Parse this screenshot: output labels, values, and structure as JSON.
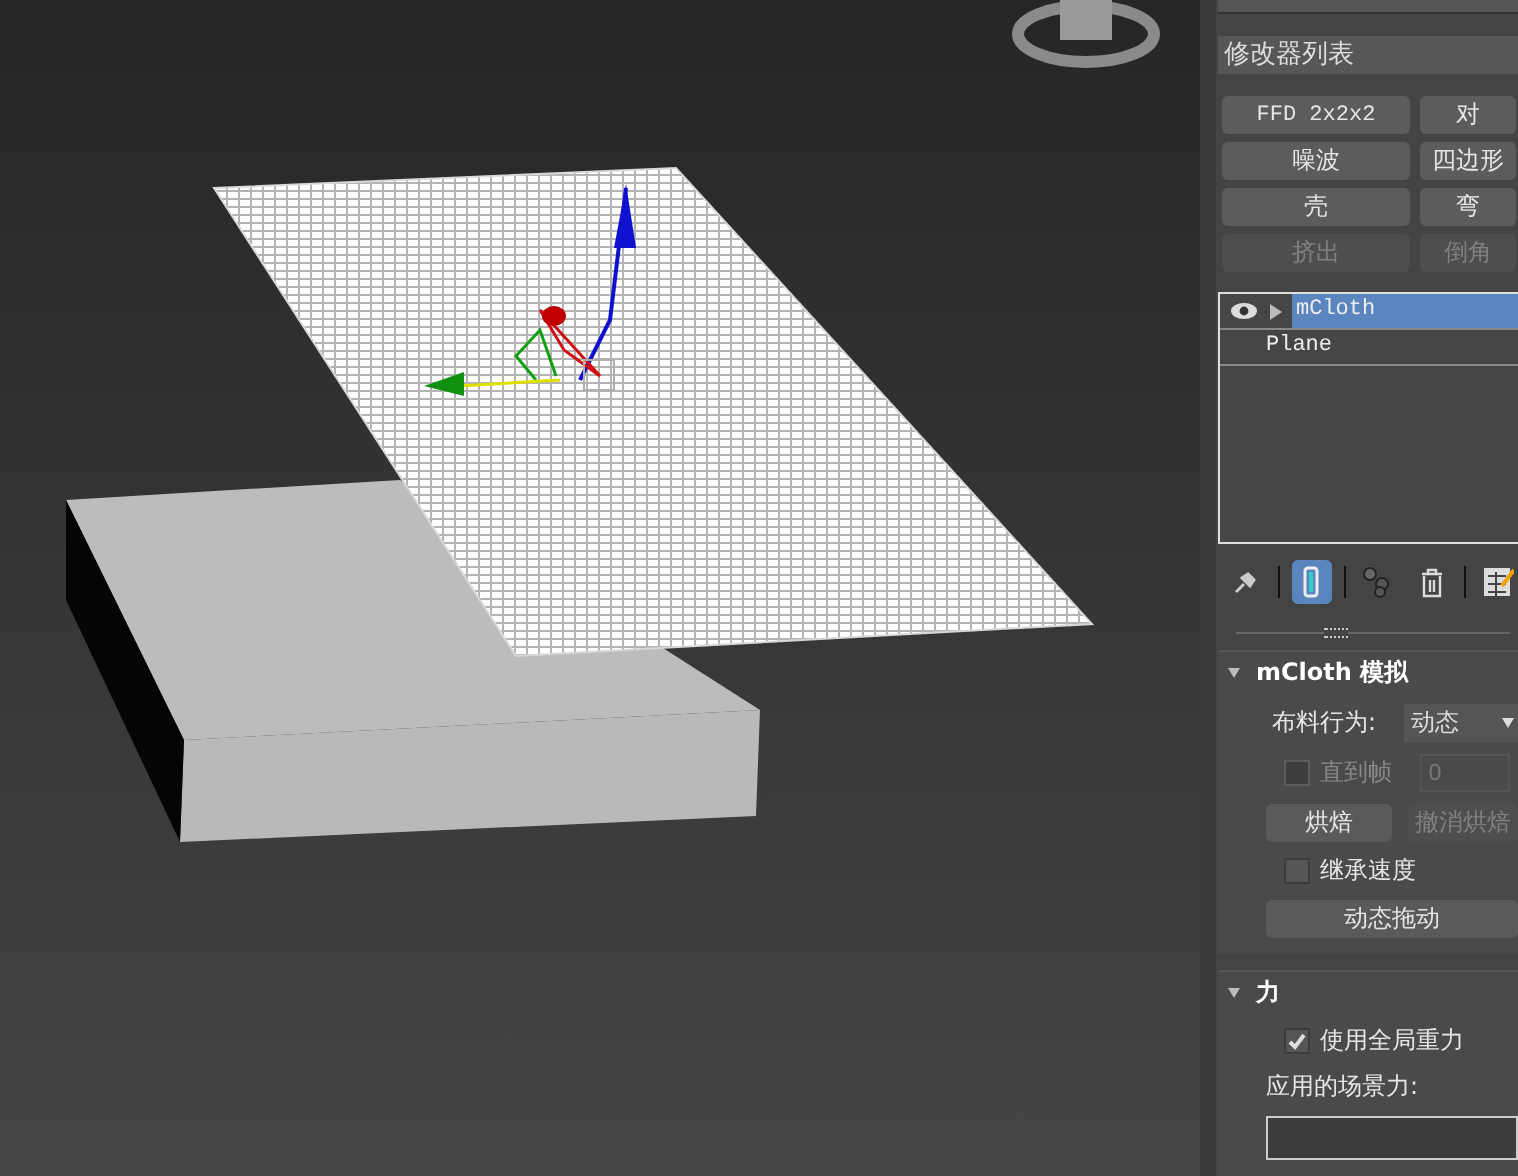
{
  "modifier_list": {
    "value": "修改器列表"
  },
  "modifier_buttons": [
    {
      "label": "FFD 2x2x2",
      "disabled": false,
      "kind": "mono"
    },
    {
      "label": "对",
      "disabled": false,
      "kind": "cjk"
    },
    {
      "label": "噪波",
      "disabled": false,
      "kind": "cjk"
    },
    {
      "label": "四边形",
      "disabled": false,
      "kind": "cjk"
    },
    {
      "label": "壳",
      "disabled": false,
      "kind": "cjk"
    },
    {
      "label": "弯",
      "disabled": false,
      "kind": "cjk"
    },
    {
      "label": "挤出",
      "disabled": true,
      "kind": "cjk"
    },
    {
      "label": "倒角",
      "disabled": true,
      "kind": "cjk"
    }
  ],
  "stack": [
    {
      "label": "mCloth",
      "selected": true,
      "kind": "modifier"
    },
    {
      "label": "Plane",
      "selected": false,
      "kind": "base"
    }
  ],
  "stack_toolbar": [
    {
      "kind": "pin",
      "selected": false
    },
    {
      "kind": "separator"
    },
    {
      "kind": "show-result",
      "selected": true
    },
    {
      "kind": "separator"
    },
    {
      "kind": "unique",
      "selected": false
    },
    {
      "kind": "trash",
      "selected": false
    },
    {
      "kind": "separator"
    },
    {
      "kind": "configure",
      "selected": false
    }
  ],
  "rollouts": [
    {
      "title": "mCloth 模拟",
      "expanded": true,
      "controls": [
        {
          "kind": "dropdown",
          "label": "布料行为:",
          "value": "动态"
        },
        {
          "kind": "checkbox-field",
          "label": "直到帧",
          "checked": false,
          "disabled": true,
          "value": "0"
        },
        {
          "kind": "button-pair",
          "buttons": [
            {
              "label": "烘焙",
              "disabled": false
            },
            {
              "label": "撤消烘焙",
              "disabled": true
            }
          ]
        },
        {
          "kind": "checkbox",
          "label": "继承速度",
          "checked": false,
          "disabled": false
        },
        {
          "kind": "button",
          "label": "动态拖动"
        }
      ]
    },
    {
      "title": "力",
      "expanded": true,
      "controls": [
        {
          "kind": "checkbox",
          "label": "使用全局重力",
          "checked": true,
          "disabled": false
        },
        {
          "kind": "label",
          "label": "应用的场景力:"
        },
        {
          "kind": "listbox"
        }
      ]
    }
  ]
}
